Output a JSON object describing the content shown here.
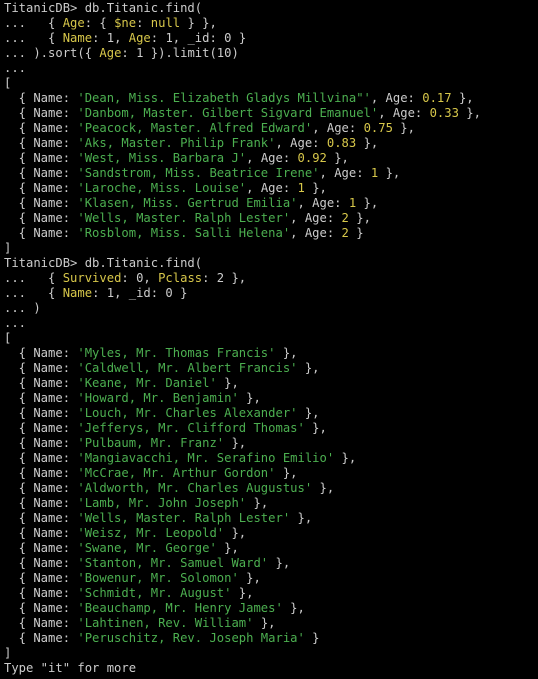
{
  "colors": {
    "background": "#000000",
    "text": "#cccccc",
    "string": "#4caf50",
    "number": "#d7c74a"
  },
  "lines": [
    [
      {
        "t": "TitanicDB> db.Titanic.find("
      }
    ],
    [
      {
        "t": "...   { "
      },
      {
        "t": "Age",
        "c": "num"
      },
      {
        "t": ": { "
      },
      {
        "t": "$ne",
        "c": "num"
      },
      {
        "t": ": "
      },
      {
        "t": "null",
        "c": "num"
      },
      {
        "t": " } },"
      }
    ],
    [
      {
        "t": "...   { "
      },
      {
        "t": "Name",
        "c": "num"
      },
      {
        "t": ": 1, "
      },
      {
        "t": "Age",
        "c": "num"
      },
      {
        "t": ": 1, _id: 0 }"
      }
    ],
    [
      {
        "t": "... ).sort({ "
      },
      {
        "t": "Age",
        "c": "num"
      },
      {
        "t": ": 1 }).limit(10)"
      }
    ],
    [
      {
        "t": "..."
      }
    ],
    [
      {
        "t": "["
      }
    ],
    [
      {
        "t": "  { Name: "
      },
      {
        "t": "'Dean, Miss. Elizabeth Gladys Millvina\"'",
        "c": "str"
      },
      {
        "t": ", Age: "
      },
      {
        "t": "0.17",
        "c": "num"
      },
      {
        "t": " },"
      }
    ],
    [
      {
        "t": "  { Name: "
      },
      {
        "t": "'Danbom, Master. Gilbert Sigvard Emanuel'",
        "c": "str"
      },
      {
        "t": ", Age: "
      },
      {
        "t": "0.33",
        "c": "num"
      },
      {
        "t": " },"
      }
    ],
    [
      {
        "t": "  { Name: "
      },
      {
        "t": "'Peacock, Master. Alfred Edward'",
        "c": "str"
      },
      {
        "t": ", Age: "
      },
      {
        "t": "0.75",
        "c": "num"
      },
      {
        "t": " },"
      }
    ],
    [
      {
        "t": "  { Name: "
      },
      {
        "t": "'Aks, Master. Philip Frank'",
        "c": "str"
      },
      {
        "t": ", Age: "
      },
      {
        "t": "0.83",
        "c": "num"
      },
      {
        "t": " },"
      }
    ],
    [
      {
        "t": "  { Name: "
      },
      {
        "t": "'West, Miss. Barbara J'",
        "c": "str"
      },
      {
        "t": ", Age: "
      },
      {
        "t": "0.92",
        "c": "num"
      },
      {
        "t": " },"
      }
    ],
    [
      {
        "t": "  { Name: "
      },
      {
        "t": "'Sandstrom, Miss. Beatrice Irene'",
        "c": "str"
      },
      {
        "t": ", Age: "
      },
      {
        "t": "1",
        "c": "num"
      },
      {
        "t": " },"
      }
    ],
    [
      {
        "t": "  { Name: "
      },
      {
        "t": "'Laroche, Miss. Louise'",
        "c": "str"
      },
      {
        "t": ", Age: "
      },
      {
        "t": "1",
        "c": "num"
      },
      {
        "t": " },"
      }
    ],
    [
      {
        "t": "  { Name: "
      },
      {
        "t": "'Klasen, Miss. Gertrud Emilia'",
        "c": "str"
      },
      {
        "t": ", Age: "
      },
      {
        "t": "1",
        "c": "num"
      },
      {
        "t": " },"
      }
    ],
    [
      {
        "t": "  { Name: "
      },
      {
        "t": "'Wells, Master. Ralph Lester'",
        "c": "str"
      },
      {
        "t": ", Age: "
      },
      {
        "t": "2",
        "c": "num"
      },
      {
        "t": " },"
      }
    ],
    [
      {
        "t": "  { Name: "
      },
      {
        "t": "'Rosblom, Miss. Salli Helena'",
        "c": "str"
      },
      {
        "t": ", Age: "
      },
      {
        "t": "2",
        "c": "num"
      },
      {
        "t": " }"
      }
    ],
    [
      {
        "t": "]"
      }
    ],
    [
      {
        "t": "TitanicDB> db.Titanic.find("
      }
    ],
    [
      {
        "t": "...   { "
      },
      {
        "t": "Survived",
        "c": "num"
      },
      {
        "t": ": 0, "
      },
      {
        "t": "Pclass",
        "c": "num"
      },
      {
        "t": ": 2 },"
      }
    ],
    [
      {
        "t": "...   { "
      },
      {
        "t": "Name",
        "c": "num"
      },
      {
        "t": ": 1, _id: 0 }"
      }
    ],
    [
      {
        "t": "... )"
      }
    ],
    [
      {
        "t": "..."
      }
    ],
    [
      {
        "t": "["
      }
    ],
    [
      {
        "t": "  { Name: "
      },
      {
        "t": "'Myles, Mr. Thomas Francis'",
        "c": "str"
      },
      {
        "t": " },"
      }
    ],
    [
      {
        "t": "  { Name: "
      },
      {
        "t": "'Caldwell, Mr. Albert Francis'",
        "c": "str"
      },
      {
        "t": " },"
      }
    ],
    [
      {
        "t": "  { Name: "
      },
      {
        "t": "'Keane, Mr. Daniel'",
        "c": "str"
      },
      {
        "t": " },"
      }
    ],
    [
      {
        "t": "  { Name: "
      },
      {
        "t": "'Howard, Mr. Benjamin'",
        "c": "str"
      },
      {
        "t": " },"
      }
    ],
    [
      {
        "t": "  { Name: "
      },
      {
        "t": "'Louch, Mr. Charles Alexander'",
        "c": "str"
      },
      {
        "t": " },"
      }
    ],
    [
      {
        "t": "  { Name: "
      },
      {
        "t": "'Jefferys, Mr. Clifford Thomas'",
        "c": "str"
      },
      {
        "t": " },"
      }
    ],
    [
      {
        "t": "  { Name: "
      },
      {
        "t": "'Pulbaum, Mr. Franz'",
        "c": "str"
      },
      {
        "t": " },"
      }
    ],
    [
      {
        "t": "  { Name: "
      },
      {
        "t": "'Mangiavacchi, Mr. Serafino Emilio'",
        "c": "str"
      },
      {
        "t": " },"
      }
    ],
    [
      {
        "t": "  { Name: "
      },
      {
        "t": "'McCrae, Mr. Arthur Gordon'",
        "c": "str"
      },
      {
        "t": " },"
      }
    ],
    [
      {
        "t": "  { Name: "
      },
      {
        "t": "'Aldworth, Mr. Charles Augustus'",
        "c": "str"
      },
      {
        "t": " },"
      }
    ],
    [
      {
        "t": "  { Name: "
      },
      {
        "t": "'Lamb, Mr. John Joseph'",
        "c": "str"
      },
      {
        "t": " },"
      }
    ],
    [
      {
        "t": "  { Name: "
      },
      {
        "t": "'Wells, Master. Ralph Lester'",
        "c": "str"
      },
      {
        "t": " },"
      }
    ],
    [
      {
        "t": "  { Name: "
      },
      {
        "t": "'Weisz, Mr. Leopold'",
        "c": "str"
      },
      {
        "t": " },"
      }
    ],
    [
      {
        "t": "  { Name: "
      },
      {
        "t": "'Swane, Mr. George'",
        "c": "str"
      },
      {
        "t": " },"
      }
    ],
    [
      {
        "t": "  { Name: "
      },
      {
        "t": "'Stanton, Mr. Samuel Ward'",
        "c": "str"
      },
      {
        "t": " },"
      }
    ],
    [
      {
        "t": "  { Name: "
      },
      {
        "t": "'Bowenur, Mr. Solomon'",
        "c": "str"
      },
      {
        "t": " },"
      }
    ],
    [
      {
        "t": "  { Name: "
      },
      {
        "t": "'Schmidt, Mr. August'",
        "c": "str"
      },
      {
        "t": " },"
      }
    ],
    [
      {
        "t": "  { Name: "
      },
      {
        "t": "'Beauchamp, Mr. Henry James'",
        "c": "str"
      },
      {
        "t": " },"
      }
    ],
    [
      {
        "t": "  { Name: "
      },
      {
        "t": "'Lahtinen, Rev. William'",
        "c": "str"
      },
      {
        "t": " },"
      }
    ],
    [
      {
        "t": "  { Name: "
      },
      {
        "t": "'Peruschitz, Rev. Joseph Maria'",
        "c": "str"
      },
      {
        "t": " }"
      }
    ],
    [
      {
        "t": "]"
      }
    ],
    [
      {
        "t": "Type \"it\" for more"
      }
    ]
  ]
}
